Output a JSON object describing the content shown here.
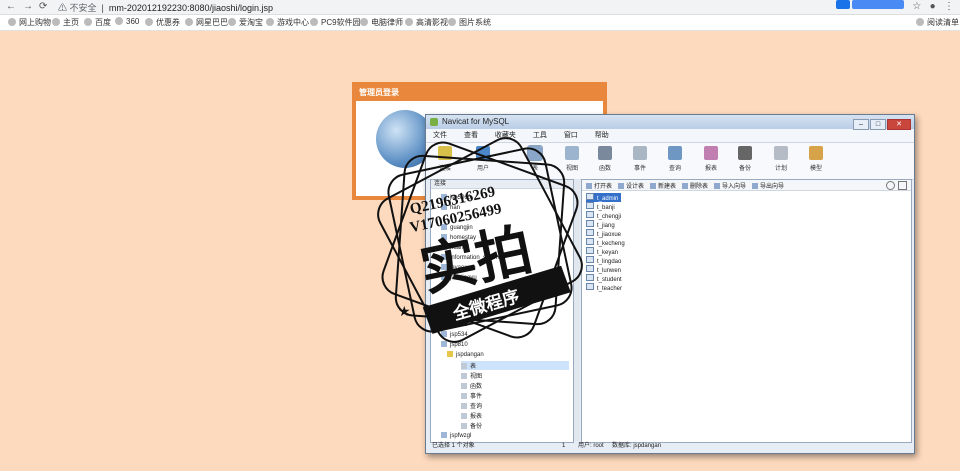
{
  "browser": {
    "security_label": "不安全",
    "url": "mm-202012192230:8080/jiaoshi/login.jsp",
    "bookmarks": [
      "网上购物",
      "主页",
      "百度",
      "360",
      "优惠券",
      "网星巴巴",
      "爱淘宝",
      "游戏中心",
      "PC9软件园",
      "电脑律师",
      "高清影视",
      "图片系统"
    ],
    "reading_list": "阅读清单"
  },
  "login": {
    "title": "管理员登录"
  },
  "navicat": {
    "title": "Navicat for MySQL",
    "menu": [
      "文件",
      "查看",
      "收藏夹",
      "工具",
      "窗口",
      "帮助"
    ],
    "toolbar": [
      "连接",
      "用户",
      "表",
      "视图",
      "函数",
      "事件",
      "查询",
      "报表",
      "备份",
      "计划",
      "模型"
    ],
    "left_header": "连接",
    "tree": [
      {
        "label": "jsp5060",
        "kind": "db"
      },
      {
        "label": "han",
        "kind": "db"
      },
      {
        "label": "guangjin",
        "kind": "db"
      },
      {
        "label": "homestay",
        "kind": "db"
      },
      {
        "label": "huangli",
        "kind": "db"
      },
      {
        "label": "information_schema",
        "kind": "db"
      },
      {
        "label": "javaexam",
        "kind": "db"
      },
      {
        "label": "javajiaoyu",
        "kind": "db"
      },
      {
        "label": "jsp418",
        "kind": "db"
      },
      {
        "label": "jsp534",
        "kind": "db"
      },
      {
        "label": "jsp810",
        "kind": "db"
      },
      {
        "label": "jspdangan",
        "kind": "open"
      },
      {
        "label": "表",
        "kind": "sel"
      },
      {
        "label": "视图",
        "kind": "child"
      },
      {
        "label": "函数",
        "kind": "child"
      },
      {
        "label": "事件",
        "kind": "child"
      },
      {
        "label": "查询",
        "kind": "child"
      },
      {
        "label": "报表",
        "kind": "child"
      },
      {
        "label": "备份",
        "kind": "child"
      },
      {
        "label": "jspfwzgl",
        "kind": "db"
      }
    ],
    "right_toolbar": [
      "打开表",
      "设计表",
      "新建表",
      "删除表",
      "导入向导",
      "导出向导"
    ],
    "tables": [
      "t_admin",
      "t_banji",
      "t_chengji",
      "t_jiang",
      "t_jiaoxue",
      "t_kecheng",
      "t_keyan",
      "t_lingdao",
      "t_lunwen",
      "t_student",
      "t_teacher"
    ],
    "status": {
      "left": "已选择 1 个对象",
      "count": "1",
      "user": "用户: root",
      "database": "数据库: jspdangan"
    }
  },
  "watermark": {
    "line1": "Q2196316269",
    "line2": "V17060256499",
    "main": "实拍",
    "banner": "全微程序"
  }
}
